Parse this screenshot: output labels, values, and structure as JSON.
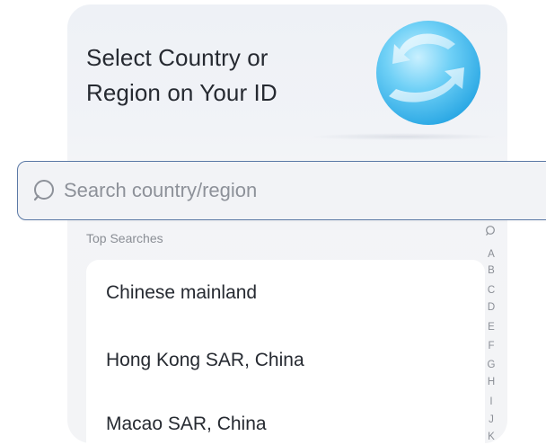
{
  "header": {
    "title_line1": "Select Country or",
    "title_line2": "Region on Your ID"
  },
  "icons": {
    "globe": "globe-arrows-icon",
    "search": "search-icon"
  },
  "search": {
    "placeholder": "Search country/region",
    "value": ""
  },
  "top_searches": {
    "label": "Top Searches",
    "items": [
      {
        "label": "Chinese mainland"
      },
      {
        "label": "Hong Kong SAR, China"
      },
      {
        "label": "Macao SAR, China"
      }
    ]
  },
  "index_bar": {
    "letters": [
      "A",
      "B",
      "C",
      "D",
      "E",
      "F",
      "G",
      "H",
      "I",
      "J",
      "K"
    ]
  },
  "colors": {
    "search_border": "#5b79a6",
    "globe_blue": "#3fb3e8",
    "text_primary": "#262a31",
    "text_secondary": "#8a8e95"
  }
}
